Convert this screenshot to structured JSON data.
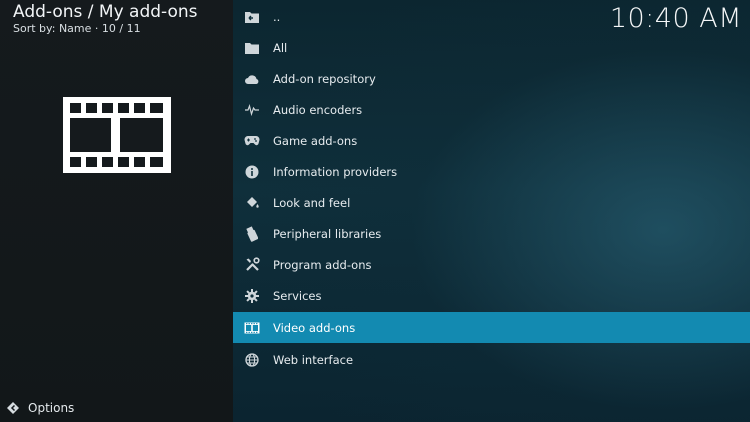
{
  "header": {
    "title": "Add-ons / My add-ons",
    "sort_info": "Sort by: Name  ·  10 / 11"
  },
  "clock": "10:40 AM",
  "preview": {
    "icon": "film-strip-icon"
  },
  "footer": {
    "options_label": "Options",
    "options_icon": "options-arrow-icon"
  },
  "list": {
    "selected_index": 10,
    "items": [
      {
        "label": "..",
        "icon": "parent-folder-icon"
      },
      {
        "label": "All",
        "icon": "folder-icon"
      },
      {
        "label": "Add-on repository",
        "icon": "cloud-icon"
      },
      {
        "label": "Audio encoders",
        "icon": "waveform-icon"
      },
      {
        "label": "Game add-ons",
        "icon": "gamepad-icon"
      },
      {
        "label": "Information providers",
        "icon": "info-icon"
      },
      {
        "label": "Look and feel",
        "icon": "paint-bucket-icon"
      },
      {
        "label": "Peripheral libraries",
        "icon": "usb-icon"
      },
      {
        "label": "Program add-ons",
        "icon": "tools-icon"
      },
      {
        "label": "Services",
        "icon": "gear-icon"
      },
      {
        "label": "Video add-ons",
        "icon": "film-icon"
      },
      {
        "label": "Web interface",
        "icon": "globe-icon"
      }
    ]
  },
  "colors": {
    "selection": "#138ab1",
    "left_bg": "#151a1d",
    "right_bg": "#0f2f3b"
  }
}
